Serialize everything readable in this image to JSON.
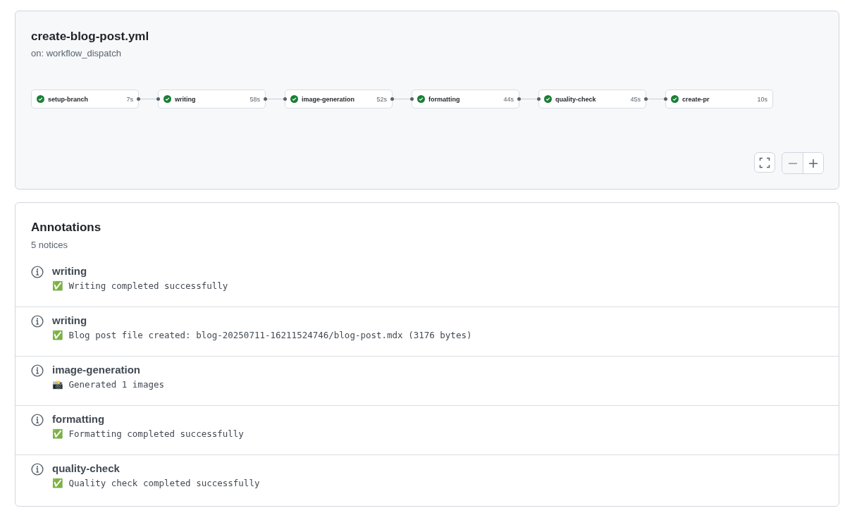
{
  "workflow": {
    "title": "create-blog-post.yml",
    "trigger": "on: workflow_dispatch",
    "jobs": [
      {
        "name": "setup-branch",
        "succeeded": true,
        "duration": "7s"
      },
      {
        "name": "writing",
        "succeeded": true,
        "duration": "58s"
      },
      {
        "name": "image-generation",
        "succeeded": true,
        "duration": "52s"
      },
      {
        "name": "formatting",
        "succeeded": true,
        "duration": "44s"
      },
      {
        "name": "quality-check",
        "succeeded": true,
        "duration": "45s"
      },
      {
        "name": "create-pr",
        "succeeded": true,
        "duration": "10s"
      }
    ]
  },
  "annotations": {
    "title": "Annotations",
    "count": "5 notices",
    "items": [
      {
        "job": "writing",
        "message": "✅ Writing completed successfully"
      },
      {
        "job": "writing",
        "message": "✅ Blog post file created: blog-20250711-16211524746/blog-post.mdx (3176 bytes)"
      },
      {
        "job": "image-generation",
        "message": "📸 Generated 1 images"
      },
      {
        "job": "formatting",
        "message": "✅ Formatting completed successfully"
      },
      {
        "job": "quality-check",
        "message": "✅ Quality check completed successfully"
      }
    ]
  }
}
